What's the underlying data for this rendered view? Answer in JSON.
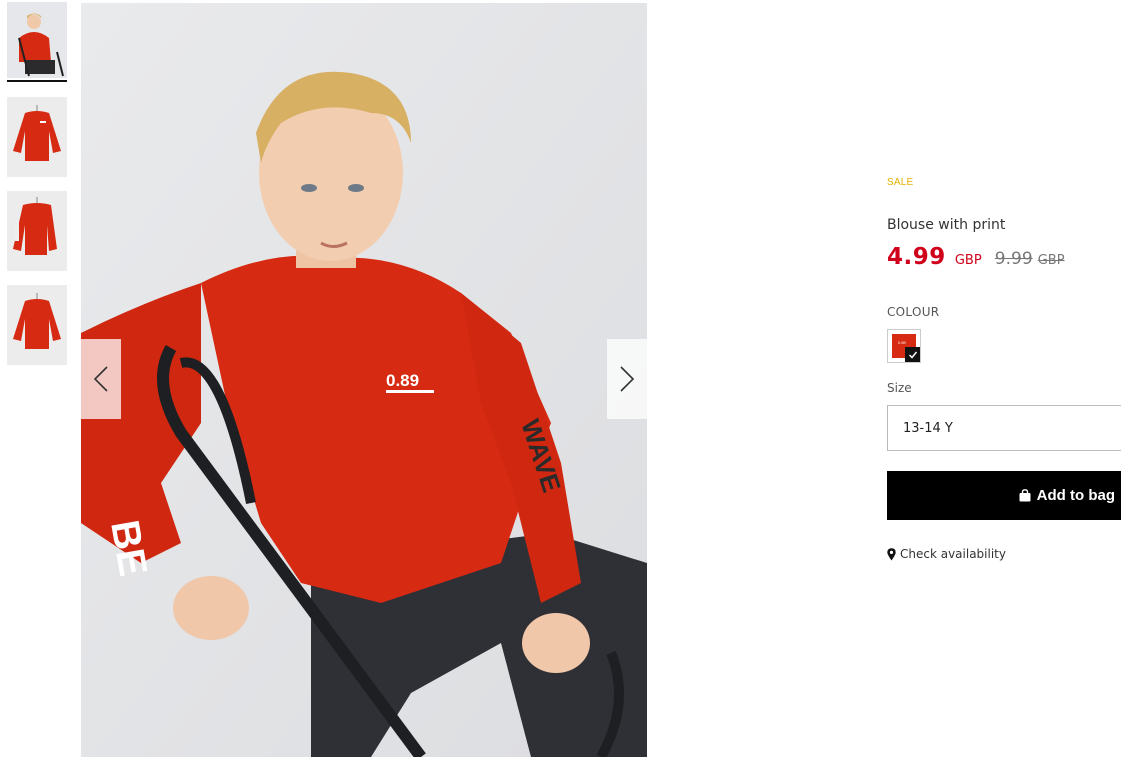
{
  "gallery": {
    "thumbnails": [
      {
        "alt": "boy-wearing-sweater",
        "active": true
      },
      {
        "alt": "sweater-front"
      },
      {
        "alt": "sweater-sleeve"
      },
      {
        "alt": "sweater-back"
      }
    ],
    "main_image": {
      "alt": "boy-sitting-on-chair-wearing-red-sweater",
      "print_text": "0.89"
    }
  },
  "product": {
    "badge": "SALE",
    "title": "Blouse with print",
    "price": {
      "current": "4.99",
      "current_currency": "GBP",
      "old": "9.99",
      "old_currency": "GBP"
    },
    "colour_label": "COLOUR",
    "selected_colour": "#d62a12",
    "swatch_text": "0.89",
    "size_label": "Size",
    "size_value": "13-14 Y",
    "add_to_bag": "Add to bag",
    "check_availability": "Check availability"
  },
  "colors": {
    "sale_badge": "#e5b200",
    "price": "#d0021b",
    "button": "#000000",
    "sweater": "#d62a12"
  }
}
